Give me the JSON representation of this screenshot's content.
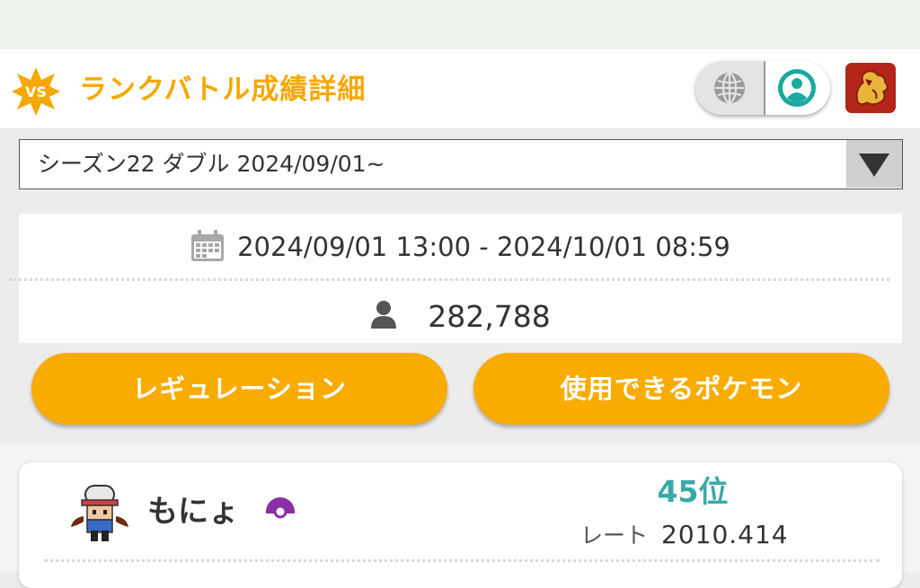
{
  "header": {
    "title": "ランクバトル成績詳細",
    "badge_text": "VS",
    "accent_color": "#f5a800",
    "icons": [
      "vs-badge-icon",
      "globe-icon",
      "user-circle-icon",
      "game-icon"
    ]
  },
  "season_select": {
    "selected": "シーズン22 ダブル 2024/09/01~"
  },
  "season_info": {
    "period": "2024/09/01 13:00 - 2024/10/01 08:59",
    "players": "282,788"
  },
  "buttons": {
    "regulation": "レギュレーション",
    "usable_pokemon": "使用できるポケモン",
    "button_color": "#f9ab00"
  },
  "player": {
    "name": "もにょ",
    "rank": "45位",
    "rate_label": "レート",
    "rate_value": "2010.414",
    "rank_color": "#3aa9a8"
  }
}
